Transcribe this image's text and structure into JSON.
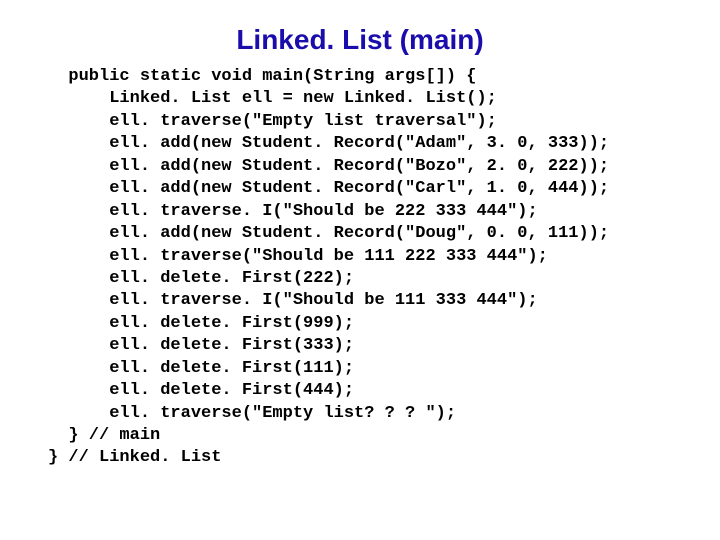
{
  "title": "Linked. List (main)",
  "code": {
    "l1": "  public static void main(String args[]) {",
    "l2": "      Linked. List ell = new Linked. List();",
    "l3": "      ell. traverse(\"Empty list traversal\");",
    "l4": "      ell. add(new Student. Record(\"Adam\", 3. 0, 333));",
    "l5": "      ell. add(new Student. Record(\"Bozo\", 2. 0, 222));",
    "l6": "      ell. add(new Student. Record(\"Carl\", 1. 0, 444));",
    "l7": "      ell. traverse. I(\"Should be 222 333 444\");",
    "l8": "      ell. add(new Student. Record(\"Doug\", 0. 0, 111));",
    "l9": "      ell. traverse(\"Should be 111 222 333 444\");",
    "l10": "      ell. delete. First(222);",
    "l11": "      ell. traverse. I(\"Should be 111 333 444\");",
    "l12": "      ell. delete. First(999);",
    "l13": "      ell. delete. First(333);",
    "l14": "      ell. delete. First(111);",
    "l15": "      ell. delete. First(444);",
    "l16": "      ell. traverse(\"Empty list? ? ? \");",
    "l17": "  } // main",
    "l18": "} // Linked. List"
  }
}
